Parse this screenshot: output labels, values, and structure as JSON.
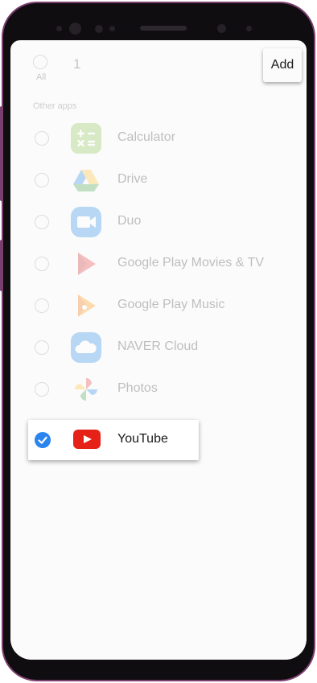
{
  "header": {
    "all_label": "All",
    "selected_count": "1",
    "add_label": "Add"
  },
  "section": {
    "label": "Other apps"
  },
  "apps": [
    {
      "label": "Calculator",
      "selected": false,
      "icon": "calculator-icon"
    },
    {
      "label": "Drive",
      "selected": false,
      "icon": "drive-icon"
    },
    {
      "label": "Duo",
      "selected": false,
      "icon": "duo-icon"
    },
    {
      "label": "Google Play Movies & TV",
      "selected": false,
      "icon": "play-movies-icon"
    },
    {
      "label": "Google Play Music",
      "selected": false,
      "icon": "play-music-icon"
    },
    {
      "label": "NAVER Cloud",
      "selected": false,
      "icon": "naver-cloud-icon"
    },
    {
      "label": "Photos",
      "selected": false,
      "icon": "photos-icon"
    },
    {
      "label": "YouTube",
      "selected": true,
      "icon": "youtube-icon"
    }
  ],
  "colors": {
    "accent": "#2a85ee",
    "youtube": "#e62117",
    "calculator": "#8bc34a",
    "duo": "#1e88e5",
    "frame": "#7a3f6e"
  }
}
